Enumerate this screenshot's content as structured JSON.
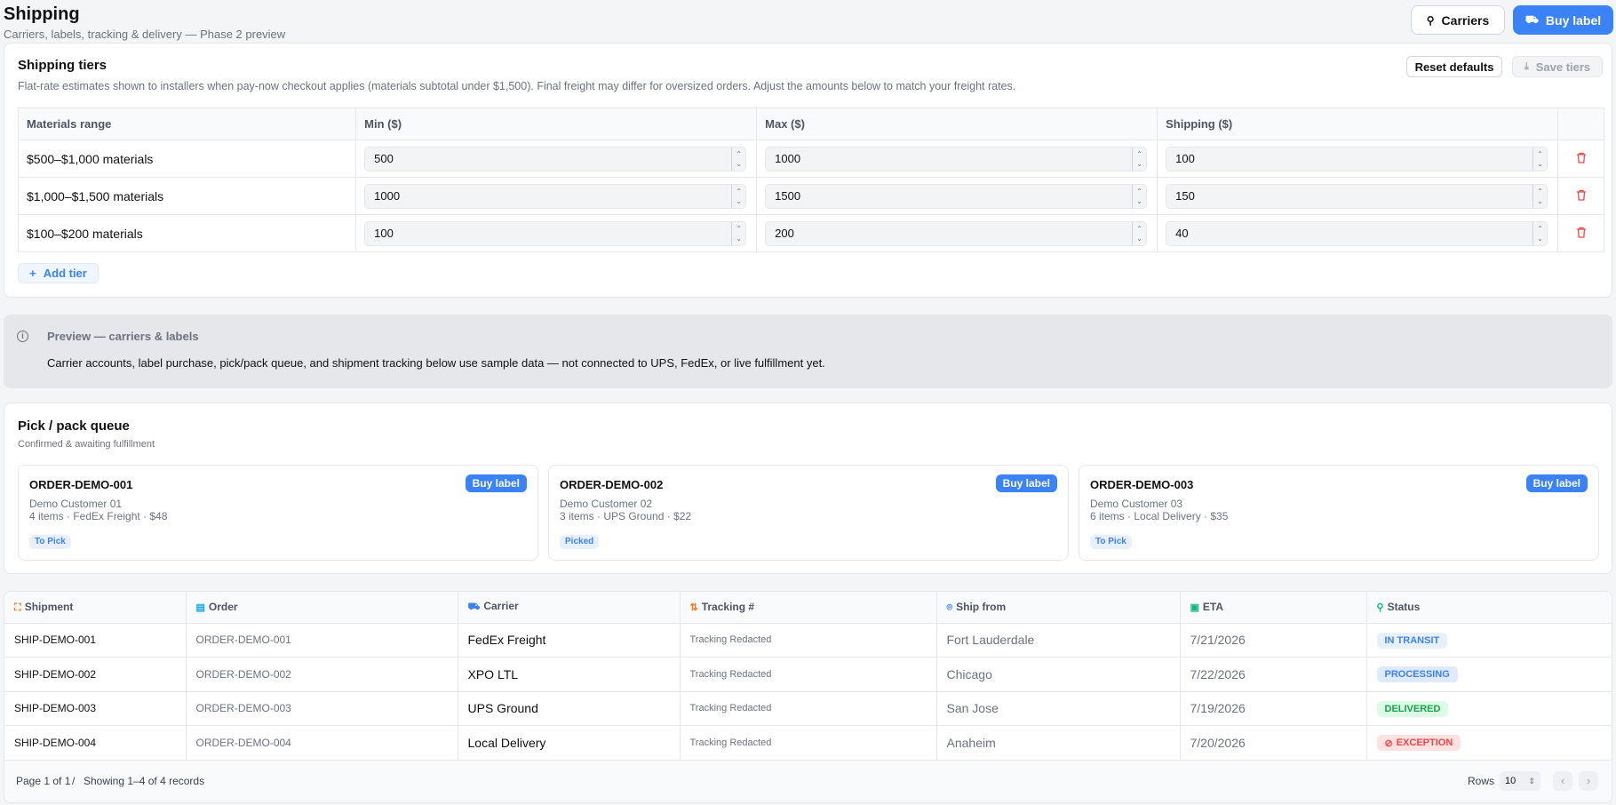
{
  "header": {
    "title": "Shipping",
    "subtitle": "Carriers, labels, tracking & delivery — Phase 2 preview",
    "carriers_label": "Carriers",
    "buy_label": "Buy label"
  },
  "tiers": {
    "title": "Shipping tiers",
    "description": "Flat-rate estimates shown to installers when pay-now checkout applies (materials subtotal under $1,500). Final freight may differ for oversized orders. Adjust the amounts below to match your freight rates.",
    "reset_label": "Reset defaults",
    "save_label": "Save tiers",
    "columns": [
      "Materials range",
      "Min ($)",
      "Max ($)",
      "Shipping ($)"
    ],
    "rows": [
      {
        "range": "$500–$1,000 materials",
        "min": "500",
        "max": "1000",
        "shipping": "100"
      },
      {
        "range": "$1,000–$1,500 materials",
        "min": "1000",
        "max": "1500",
        "shipping": "150"
      },
      {
        "range": "$100–$200 materials",
        "min": "100",
        "max": "200",
        "shipping": "40"
      }
    ],
    "add_label": "Add tier"
  },
  "preview": {
    "title": "Preview — carriers & labels",
    "body": "Carrier accounts, label purchase, pick/pack queue, and shipment tracking below use sample data — not connected to UPS, FedEx, or live fulfillment yet."
  },
  "queue": {
    "title": "Pick / pack queue",
    "subtitle": "Confirmed & awaiting fulfillment",
    "buy_label": "Buy label",
    "items": [
      {
        "id": "ORDER-DEMO-001",
        "customer": "Demo Customer 01",
        "meta": "4 items · FedEx Freight · $48",
        "status": "To Pick"
      },
      {
        "id": "ORDER-DEMO-002",
        "customer": "Demo Customer 02",
        "meta": "3 items · UPS Ground · $22",
        "status": "Picked"
      },
      {
        "id": "ORDER-DEMO-003",
        "customer": "Demo Customer 03",
        "meta": "6 items · Local Delivery · $35",
        "status": "To Pick"
      }
    ]
  },
  "shipments": {
    "columns": [
      "Shipment",
      "Order",
      "Carrier",
      "Tracking #",
      "Ship from",
      "ETA",
      "Status"
    ],
    "rows": [
      {
        "shipment": "SHIP-DEMO-001",
        "order": "ORDER-DEMO-001",
        "carrier": "FedEx Freight",
        "tracking": "Tracking Redacted",
        "from": "Fort Lauderdale",
        "eta": "7/21/2026",
        "status": "IN TRANSIT"
      },
      {
        "shipment": "SHIP-DEMO-002",
        "order": "ORDER-DEMO-002",
        "carrier": "XPO LTL",
        "tracking": "Tracking Redacted",
        "from": "Chicago",
        "eta": "7/22/2026",
        "status": "PROCESSING"
      },
      {
        "shipment": "SHIP-DEMO-003",
        "order": "ORDER-DEMO-003",
        "carrier": "UPS Ground",
        "tracking": "Tracking Redacted",
        "from": "San Jose",
        "eta": "7/19/2026",
        "status": "DELIVERED"
      },
      {
        "shipment": "SHIP-DEMO-004",
        "order": "ORDER-DEMO-004",
        "carrier": "Local Delivery",
        "tracking": "Tracking Redacted",
        "from": "Anaheim",
        "eta": "7/20/2026",
        "status": "EXCEPTION"
      }
    ],
    "pagination": {
      "page": "Page 1 of 1",
      "separator": "/",
      "showing": "Showing 1–4 of 4 records",
      "rows_label": "Rows",
      "rows_value": "10"
    }
  },
  "colors": {
    "accent": "#3b82f6",
    "danger": "#ef4444",
    "transit_bg": "#e8f0fe",
    "processing_bg": "#e0eaff",
    "delivered_bg": "#dcfce7",
    "delivered_fg": "#16a34a",
    "exception_bg": "#fee2e2"
  }
}
